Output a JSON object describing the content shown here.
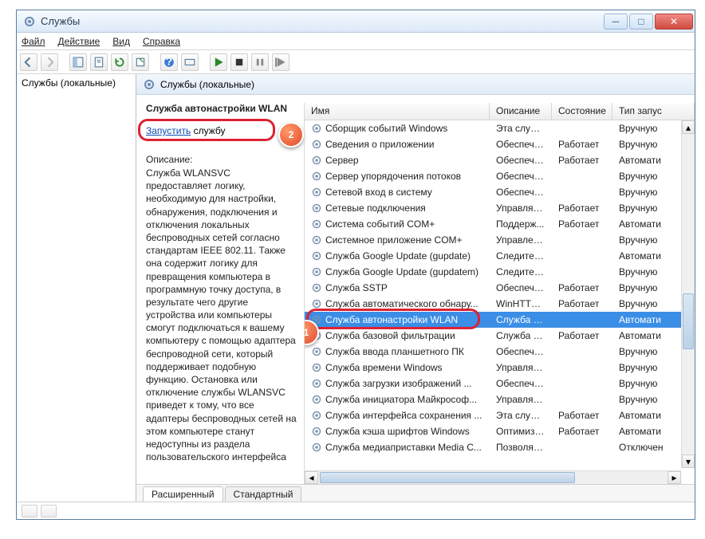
{
  "window": {
    "title": "Службы"
  },
  "menus": {
    "file": "Файл",
    "action": "Действие",
    "view": "Вид",
    "help": "Справка"
  },
  "tree": {
    "root": "Службы (локальные)"
  },
  "header": {
    "title": "Службы (локальные)"
  },
  "details": {
    "service_name": "Служба автонастройки WLAN",
    "start_link": "Запустить",
    "start_suffix": " службу",
    "desc_label": "Описание:",
    "desc_text": "Служба WLANSVC предоставляет логику, необходимую для настройки, обнаружения, подключения и отключения локальных беспроводных сетей согласно стандартам IEEE 802.11. Также она содержит логику для превращения компьютера в программную точку доступа, в результате чего другие устройства или компьютеры смогут подключаться к вашему компьютеру с помощью адаптера беспроводной сети, который поддерживает подобную функцию. Остановка или отключение службы WLANSVC приведет к тому, что все адаптеры беспроводных сетей на этом компьютере станут недоступны из раздела пользовательского интерфейса"
  },
  "columns": {
    "name": "Имя",
    "desc": "Описание",
    "state": "Состояние",
    "start": "Тип запус"
  },
  "services": [
    {
      "name": "Сборщик событий Windows",
      "desc": "Эта служб...",
      "state": "",
      "start": "Вручную"
    },
    {
      "name": "Сведения о приложении",
      "desc": "Обеспечи...",
      "state": "Работает",
      "start": "Вручную"
    },
    {
      "name": "Сервер",
      "desc": "Обеспечи...",
      "state": "Работает",
      "start": "Автомати"
    },
    {
      "name": "Сервер упорядочения потоков",
      "desc": "Обеспечи...",
      "state": "",
      "start": "Вручную"
    },
    {
      "name": "Сетевой вход в систему",
      "desc": "Обеспечи...",
      "state": "",
      "start": "Вручную"
    },
    {
      "name": "Сетевые подключения",
      "desc": "Управляе...",
      "state": "Работает",
      "start": "Вручную"
    },
    {
      "name": "Система событий COM+",
      "desc": "Поддерж...",
      "state": "Работает",
      "start": "Автомати"
    },
    {
      "name": "Системное приложение COM+",
      "desc": "Управлен...",
      "state": "",
      "start": "Вручную"
    },
    {
      "name": "Служба Google Update (gupdate)",
      "desc": "Следите за...",
      "state": "",
      "start": "Автомати"
    },
    {
      "name": "Служба Google Update (gupdatem)",
      "desc": "Следите за...",
      "state": "",
      "start": "Вручную"
    },
    {
      "name": "Служба SSTP",
      "desc": "Обеспечи...",
      "state": "Работает",
      "start": "Вручную"
    },
    {
      "name": "Служба автоматического обнару...",
      "desc": "WinHTTP ...",
      "state": "Работает",
      "start": "Вручную"
    },
    {
      "name": "Служба автонастройки WLAN",
      "desc": "Служба W...",
      "state": "",
      "start": "Автомати",
      "selected": true
    },
    {
      "name": "Служба базовой фильтрации",
      "desc": "Служба ба...",
      "state": "Работает",
      "start": "Автомати"
    },
    {
      "name": "Служба ввода планшетного ПК",
      "desc": "Обеспечи...",
      "state": "",
      "start": "Вручную"
    },
    {
      "name": "Служба времени Windows",
      "desc": "Управляе...",
      "state": "",
      "start": "Вручную"
    },
    {
      "name": "Служба загрузки изображений ...",
      "desc": "Обеспечи...",
      "state": "",
      "start": "Вручную"
    },
    {
      "name": "Служба инициатора Майкрософ...",
      "desc": "Управляе...",
      "state": "",
      "start": "Вручную"
    },
    {
      "name": "Служба интерфейса сохранения ...",
      "desc": "Эта служб...",
      "state": "Работает",
      "start": "Автомати"
    },
    {
      "name": "Служба кэша шрифтов Windows",
      "desc": "Оптимизи...",
      "state": "Работает",
      "start": "Автомати"
    },
    {
      "name": "Служба медиаприставки Media C...",
      "desc": "Позволяе...",
      "state": "",
      "start": "Отключен"
    }
  ],
  "tabs": {
    "extended": "Расширенный",
    "standard": "Стандартный"
  },
  "badges": {
    "one": "1",
    "two": "2"
  }
}
